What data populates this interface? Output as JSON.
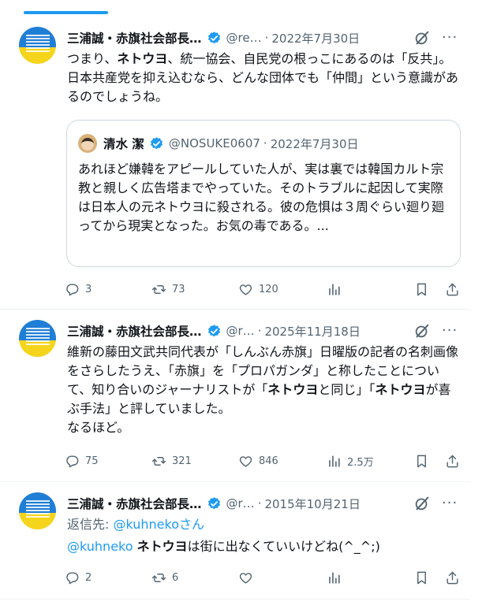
{
  "tweets": [
    {
      "name": "三浦誠・赤旗社会部長…",
      "handle": "@re…",
      "date": "2022年7月30日",
      "text_parts": [
        "つまり、",
        "ネトウヨ",
        "、統一協会、自民党の根っこにあるのは「反共」。日本共産党を抑え込むなら、どんな団体でも「仲間」という意識があるのでしょうね。"
      ],
      "quote": {
        "name": "清水 潔",
        "handle": "@NOSUKE0607",
        "date": "2022年7月30日",
        "text": "あれほど嫌韓をアピールしていた人が、実は裏では韓国カルト宗教と親しく広告塔までやっていた。そのトラブルに起因して実際は日本人の元ネトウヨに殺される。彼の危惧は３周ぐらい廻り廻ってから現実となった。お気の毒である。..."
      },
      "replies": "3",
      "reposts": "73",
      "likes": "120",
      "views": ""
    },
    {
      "name": "三浦誠・赤旗社会部長…",
      "handle": "@r…",
      "date": "2025年11月18日",
      "text_parts": [
        "維新の藤田文武共同代表が「しんぶん赤旗」日曜版の記者の名刺画像をさらしたうえ、「赤旗」を「プロパガンダ」と称したことについて、知り合いのジャーナリストが「",
        "ネトウヨ",
        "と同じ」「",
        "ネトウヨ",
        "が喜ぶ手法」と評していました。",
        "なるほど。"
      ],
      "replies": "75",
      "reposts": "321",
      "likes": "846",
      "views": "2.5万"
    },
    {
      "name": "三浦誠・赤旗社会部長…",
      "handle": "@r…",
      "date": "2015年10月21日",
      "reply_label": "返信先: ",
      "reply_handle": "@kuhneko",
      "reply_suffix": "さん",
      "text_parts": [
        "@kuhneko",
        " ",
        "ネトウヨ",
        "は街に出なくていいけどね(^_^;)"
      ],
      "replies": "2",
      "reposts": "6",
      "likes": "",
      "views": ""
    }
  ],
  "icons": {
    "reply": "speech-bubble-icon",
    "repost": "repost-arrows-icon",
    "like": "heart-icon",
    "views": "bar-chart-icon",
    "bookmark": "bookmark-icon",
    "share": "share-icon",
    "grok": "grok-icon",
    "more": "more-icon",
    "verified": "verified-badge-icon"
  },
  "colors": {
    "accent": "#1d9bf0",
    "text": "#0f1419",
    "muted": "#536471"
  }
}
